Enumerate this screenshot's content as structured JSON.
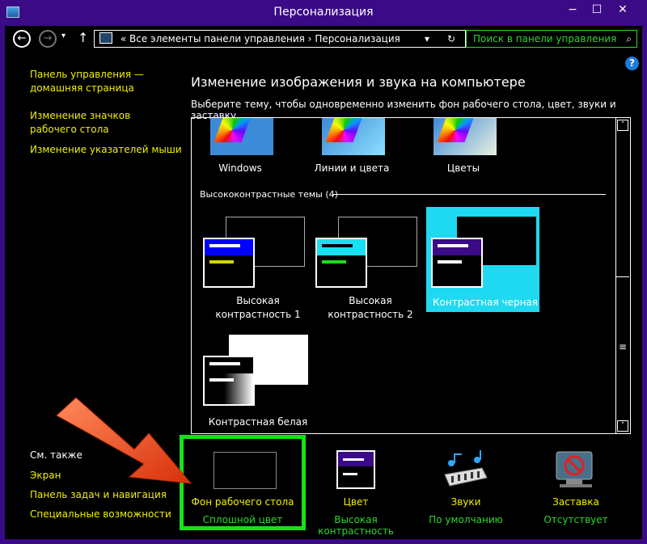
{
  "window": {
    "title": "Персонализация",
    "minimize": "−",
    "maximize": "☐",
    "close": "✕"
  },
  "address": {
    "prefix": "«",
    "path_part1": "Все элементы панели управления",
    "separator": "›",
    "path_part2": "Персонализация",
    "dropdown": "▾",
    "refresh": "↻",
    "search_placeholder": "Поиск в панели управления",
    "search_icon": "⌕"
  },
  "nav": {
    "back": "←",
    "forward": "→",
    "recent": "▾",
    "up": "↑"
  },
  "help": "?",
  "sidebar": {
    "links": [
      "Панель управления —",
      "домашняя страница",
      "Изменение значков",
      "рабочего стола",
      "Изменение указателей мыши"
    ]
  },
  "main": {
    "heading": "Изменение изображения и звука на компьютере",
    "subtitle": "Выберите тему, чтобы одновременно изменить фон рабочего стола, цвет, звуки и заставку."
  },
  "themes": {
    "top": [
      "Windows",
      "Линии и цвета",
      "Цветы"
    ],
    "group_title": "Высококонтрастные темы (4)",
    "high_contrast": [
      {
        "line1": "Высокая",
        "line2": "контрастность 1",
        "bar_color": "#0000ff",
        "accent": "#d4d400"
      },
      {
        "line1": "Высокая",
        "line2": "контрастность 2",
        "bar_color": "#18e0f0",
        "accent": "#18e018"
      },
      {
        "line1": "Контрастная черная",
        "line2": "",
        "bar_color": "#3b0a86",
        "accent": "#ffffff"
      },
      {
        "line1": "Контрастная белая",
        "line2": "",
        "bar_color": "#000000",
        "accent": "#ffffff"
      }
    ]
  },
  "see_also": {
    "caption": "См. также",
    "links": [
      "Экран",
      "Панель задач и навигация",
      "Специальные возможности"
    ]
  },
  "bottom": [
    {
      "title": "Фон рабочего стола",
      "value": "Сплошной цвет"
    },
    {
      "title": "Цвет",
      "value": "Высокая контрастность"
    },
    {
      "title": "Звуки",
      "value": "По умолчанию"
    },
    {
      "title": "Заставка",
      "value": "Отсутствует"
    }
  ],
  "scrollbar": {
    "up": "˄",
    "grip": "≡",
    "down": "˅"
  },
  "colors": {
    "title_bar": "#3b0a86",
    "link": "#f0f000",
    "accent_green": "#2ed62e",
    "highlight": "#18e018",
    "selected": "#1fd9f0"
  }
}
